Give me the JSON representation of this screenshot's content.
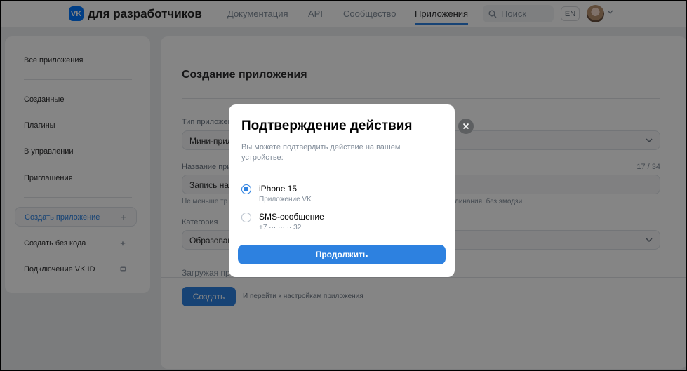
{
  "header": {
    "logo_badge": "VK",
    "logo_text": "для разработчиков",
    "nav": [
      "Документация",
      "API",
      "Сообщество",
      "Приложения"
    ],
    "active_nav": "Приложения",
    "search_placeholder": "Поиск",
    "lang": "EN",
    "accent": "#2d81e0"
  },
  "sidebar": {
    "items": [
      "Все приложения",
      "Созданные",
      "Плагины",
      "В управлении",
      "Приглашения",
      "Создать приложение",
      "Создать без кода",
      "Подключение VK ID"
    ],
    "active": "Создать приложение"
  },
  "form": {
    "title": "Создание приложения",
    "type_label": "Тип приложения",
    "type_value": "Мини-приложение",
    "name_label": "Название приложения",
    "name_value": "Запись на ",
    "name_counter": "17 / 34",
    "name_hint_start": "Не меньше тр",
    "name_hint_end": "линания, без эмодзи",
    "category_label": "Категория",
    "category_value": "Образован",
    "loading_label": "Загружая пр",
    "create_button": "Создать",
    "after_create": "И перейти к настройкам приложения"
  },
  "modal": {
    "title": "Подтверждение действия",
    "subtitle": "Вы можете подтвердить действие на вашем устройстве:",
    "options": [
      {
        "title": "iPhone 15",
        "subtitle": "Приложение VK",
        "checked": true
      },
      {
        "title": "SMS-сообщение",
        "subtitle": "+7 ··· ··· ·· 32",
        "checked": false
      }
    ],
    "continue_button": "Продолжить"
  }
}
